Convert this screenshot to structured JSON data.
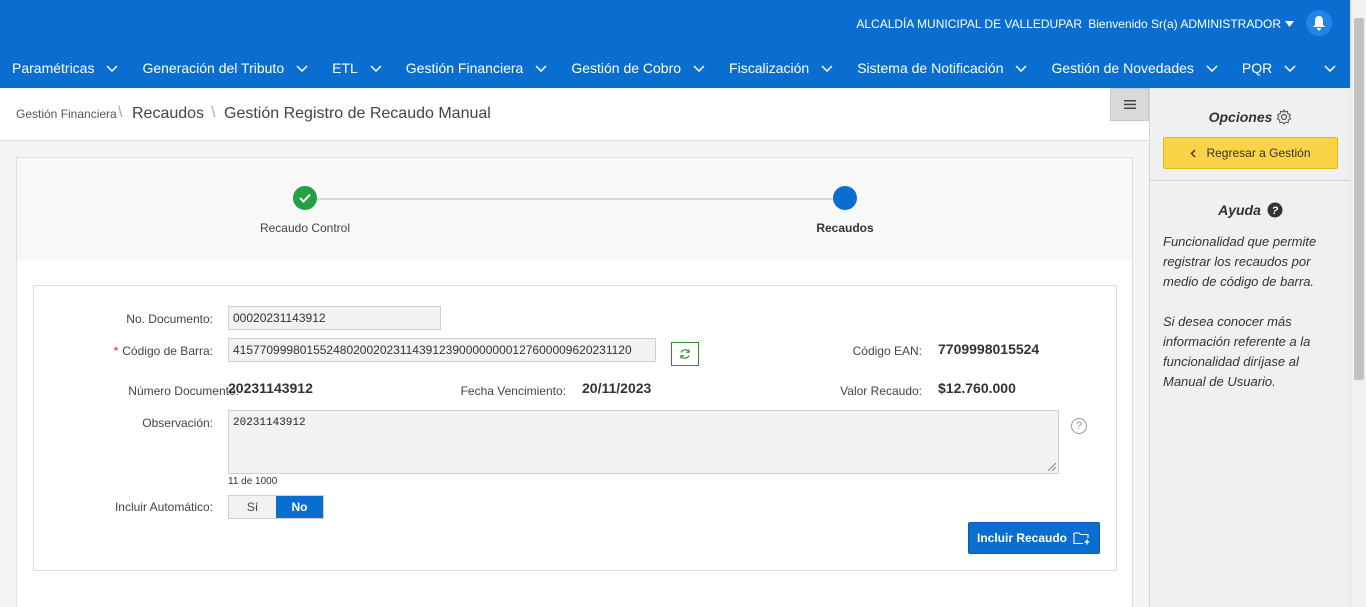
{
  "header": {
    "organization": "ALCALDÍA MUNICIPAL DE VALLEDUPAR",
    "welcome": "Bienvenido Sr(a) ADMINISTRADOR",
    "brand_color": "#0a6ed1"
  },
  "nav": {
    "items": [
      {
        "label": "Paramétricas"
      },
      {
        "label": "Generación del Tributo"
      },
      {
        "label": "ETL"
      },
      {
        "label": "Gestión Financiera"
      },
      {
        "label": "Gestión de Cobro"
      },
      {
        "label": "Fiscalización"
      },
      {
        "label": "Sistema de Notificación"
      },
      {
        "label": "Gestión de Novedades"
      },
      {
        "label": "PQR"
      }
    ]
  },
  "breadcrumb": {
    "level1": "Gestión Financiera",
    "level2": "Recaudos",
    "current": "Gestión Registro de Recaudo Manual"
  },
  "wizard": {
    "steps": [
      {
        "label": "Recaudo Control",
        "status": "complete"
      },
      {
        "label": "Recaudos",
        "status": "current"
      }
    ]
  },
  "form": {
    "no_documento_label": "No. Documento:",
    "no_documento_value": "00020231143912",
    "codigo_barra_label": "Código de Barra:",
    "codigo_barra_value": "415770999801552480200202311439123900000000127600009620231120",
    "codigo_ean_label": "Código EAN:",
    "codigo_ean_value": "7709998015524",
    "numero_documento_label": "Número Documento:",
    "numero_documento_value": "20231143912",
    "fecha_vencimiento_label": "Fecha Vencimiento:",
    "fecha_vencimiento_value": "20/11/2023",
    "valor_recaudo_label": "Valor Recaudo:",
    "valor_recaudo_value": "$12.760.000",
    "observacion_label": "Observación:",
    "observacion_value": "20231143912",
    "observacion_counter": "11 de 1000",
    "incluir_automatico_label": "Incluir Automático:",
    "toggle_si": "Sí",
    "toggle_no": "No",
    "toggle_selected": "No",
    "include_button": "Incluir Recaudo"
  },
  "sidebar": {
    "opciones_title": "Opciones",
    "back_button": "Regresar a Gestión",
    "ayuda_title": "Ayuda",
    "help_paragraph1": "Funcionalidad que permite registrar los recaudos por medio de código de barra.",
    "help_paragraph2": "Si desea conocer más información referente a la funcionalidad diríjase al Manual de Usuario."
  }
}
